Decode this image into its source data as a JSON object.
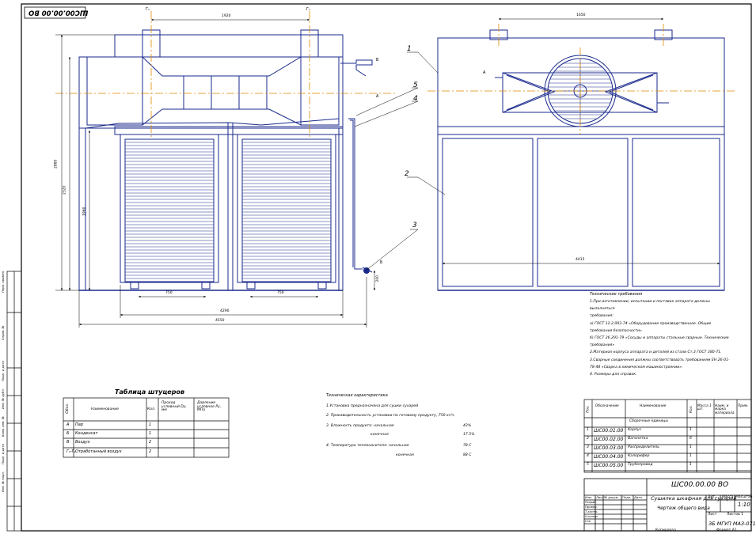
{
  "stamp_code": "ШС00.00.00 ВО",
  "dims": {
    "top_1920": "1920",
    "right_1650": "1650",
    "left_2880": "2880",
    "left_2320": "2320",
    "left_1960": "1960",
    "d_750_a": "750",
    "d_750_b": "750",
    "d_4290": "4290",
    "d_4550": "4550",
    "d_200": "200",
    "d_4415": "4415"
  },
  "markers": {
    "g1a": "Г₁",
    "g1b": "Г₁",
    "a": "А",
    "a2": "А",
    "b": "Б",
    "v": "В"
  },
  "callouts": [
    "1",
    "2",
    "3",
    "4",
    "5"
  ],
  "tech_requirements": {
    "title": "Технические требования",
    "lines": [
      "1.При изготовлении, испытании и поставке аппарата должны",
      "выполняться",
      "требования:",
      "  а) ГОСТ 12.2.003-74 «Оборудование производственное. Общие",
      "требования безопасности»",
      "  б) ГОСТ 26.291-79 «Сосуды и аппараты стальные сварные. Технические",
      "требования»",
      "2.Материал корпуса аппарата и деталей из стали Ст.3 ГОСТ 380-71.",
      "3.Сварные соединения должны соответствовать требованиям ЕН 26-01-",
      "78-48 «Сварка в химическом машиностроении».",
      "4. Размеры для справок."
    ]
  },
  "nozzle_table": {
    "title": "Таблица штуцеров",
    "headers": [
      "Обоз.",
      "Наименование",
      "Кол.",
      "Проход условный Dу, мм",
      "Давление условное Ру, МПа"
    ],
    "rows": [
      [
        "А",
        "Пар",
        "1",
        "",
        ""
      ],
      [
        "Б",
        "Конденсат",
        "1",
        "",
        ""
      ],
      [
        "В",
        "Воздух",
        "2",
        "",
        ""
      ],
      [
        "Г₁-Г₂",
        "Отработанный воздух",
        "2",
        "",
        ""
      ]
    ]
  },
  "tech_characteristics": {
    "title": "Техническая характеристика",
    "lines": [
      {
        "label": "1.Установка предназначена для сушки сухарей",
        "value": ""
      },
      {
        "label": "2. Производительность установки по готовому продукту, 750 кг/ч.",
        "value": ""
      },
      {
        "label": "3. Влажность продукта: начальная",
        "value": "43%"
      },
      {
        "label": "конечная",
        "value": "17.5%"
      },
      {
        "label": "4. Температура теплоносителя: начальная",
        "value": "78 С"
      },
      {
        "label": "конечная",
        "value": "88 С"
      }
    ]
  },
  "spec_table": {
    "headers": [
      "Поз.",
      "Обозначение",
      "Наименование",
      "Кол.",
      "Масса 1 шт.",
      "Наим. и марка материала",
      "Прим."
    ],
    "section": "Сборочные единицы",
    "rows": [
      [
        "1",
        "ШС00.01.00",
        "Корпус",
        "1"
      ],
      [
        "2",
        "ШС00.02.00",
        "Вагонетка",
        "6"
      ],
      [
        "3",
        "ШС00.03.00",
        "Распределитель",
        "1"
      ],
      [
        "4",
        "ШС00.04.00",
        "Калорифер",
        "1"
      ],
      [
        "5",
        "ШС00.05.00",
        "Трубопровод",
        "1"
      ]
    ]
  },
  "title_block": {
    "code": "ШС00.00.00 ВО",
    "name": "Сушилка шкафная для сухарей",
    "subtitle": "Чертеж общего вида",
    "lit": "Лит.",
    "mass": "Масса",
    "scale_label": "Масштаб",
    "scale": "1:10",
    "org": "ЗБ МГУП МАЗ-071",
    "sheet": "Лист",
    "sheets": "Листов 1",
    "rows": [
      "Изм.",
      "Лист",
      "№ докум.",
      "Подп.",
      "Дата"
    ],
    "roles": [
      "Разраб.",
      "Провер.",
      "Т.контр.",
      "Н.контр.",
      "Утв."
    ],
    "copied": "Копировал",
    "format": "Формат   А1"
  },
  "side_strip": [
    "Перв. примен.",
    "Справ. №",
    "Подп. и дата",
    "Инв. № дубл.",
    "Взам. инв. №",
    "Подп. и дата",
    "Инв. № подл."
  ]
}
